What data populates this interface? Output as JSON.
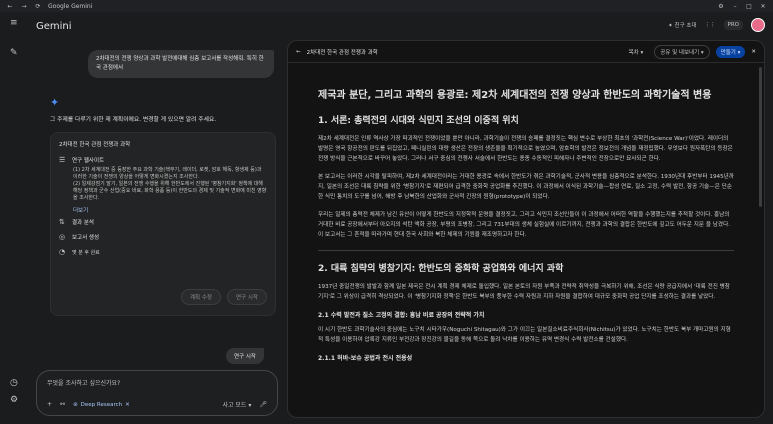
{
  "browser": {
    "tab": "Google Gemini"
  },
  "app": {
    "name": "Gemini",
    "invite": "친구 초대",
    "pro": "PRO"
  },
  "chat": {
    "user_message": "2차대전의 전쟁 양상과 과학 발전에대해 심층 보고서를 작성해줘. 특히 한국 관점에서",
    "reply": "그 주제를 다루기 위한 제 계획이에요. 변경할 게 있으면 알려 주세요.",
    "plan": {
      "title": "2차대전 한국 관점 전쟁과 과학",
      "step1": "연구 웹사이트",
      "step1_desc": "(1) 2차 세계대전 중 등장한 주요 과학 기술(핵무기, 레이더, 로켓, 암호 해독, 항생제 등)과 이러한 기술이 전쟁의 양상을 어떻게 변화시켰는지 조사한다.\n(2) 일제강점기 말기, 일본의 전쟁 수행을 위해 한반도에서 진행된 '병참기지화' 정책에 대해 해당 정책과 군수 산업(중요 비료, 화학 용품 등)이 한반도의 경제 및 기술적 변화에 미친 영향을 조사한다.",
      "more": "더보기",
      "step2": "결과 분석",
      "step3": "보고서 생성",
      "eta": "몇 분 후 완료",
      "edit_btn": "계획 수정",
      "start_btn": "연구 시작"
    },
    "start_msg": "연구 시작"
  },
  "input": {
    "placeholder": "무엇을 조사하고 싶으신가요?",
    "deep_research": "Deep Research",
    "mode": "사고 모드"
  },
  "panel": {
    "title": "2차대전 한국 관점 전쟁과 과학",
    "toc": "목차",
    "share": "공유 및 내보내기",
    "create": "만들기",
    "h1": "제국과 분단, 그리고 과학의 용광로: 제2차 세계대전의 전쟁 양상과 한반도의 과학기술적 변용",
    "s1": "1. 서론: 총력전의 시대와 식민지 조선의 이중적 위치",
    "p1": "제2차 세계대전은 인류 역사상 가장 파괴적인 전쟁이었을 뿐만 아니라, 과학기술이 전쟁의 승패를 결정짓는 핵심 변수로 부상한 최초의 '과학전(Science War)'이었다. 레이더의 발명은 영국 항공전의 판도를 뒤집었고, 페니실린의 대량 생산은 전장의 생존율을 획기적으로 높였으며, 암호학의 발전은 정보전의 개념을 재정립했다. 무엇보다 원자폭탄의 등장은 전쟁 방식을 근본적으로 바꾸어 놓았다. 그러나 서구 중심의 전쟁사 서술에서 한반도는 종종 수동적인 피해자나 주변적인 전장으로만 묘사되곤 한다.",
    "p2": "본 보고서는 이러한 시각을 탈피하여, 제2차 세계대전이라는 거대한 용광로 속에서 한반도가 겪은 과학기술적, 군사적 변용을 심층적으로 분석한다. 1930년대 후반부터 1945년까지, 일본의 조선은 대륙 침략을 위한 '병참기지'로 재편되어 급격한 중화학 공업화를 추진했다. 이 과정에서 이식된 과학기술—합성 연료, 질소 고정, 수력 발전, 항공 기술—은 단순한 식민 통치의 도구를 넘어, 해방 후 남북한의 산업화와 군사적 긴장의 원형(prototype)이 되었다.",
    "p3": "우리는 일제의 총력전 체제가 남긴 유산이 어떻게 한반도의 지정학적 운명을 결정짓고, 그리고 식민지 조선인들이 이 과정에서 어떠한 역할을 수행했는지를 추적할 것이다. 흥남의 거대한 비료 공장에서부터 아오지의 석탄 액화 공장, 부평의 조병창, 그리고 731부대의 생체 실험실에 이르기까지, 전쟁과 과학의 결합은 한반도에 깊고도 어두운 지문 을 남겼다. 이 보고서는 그 흔적을 따라가며 현대 한국 사회와 북한 체제의 기원을 재조명하고자 한다.",
    "s2": "2. 대륙 침략의 병참기지: 한반도의 중화학 공업화와 에너지 과학",
    "p4": "1937년 중일전쟁의 발발과 함께 일본 제국은 전시 계획 경제 체제로 돌입했다. 일본 본토의 자원 부족과 전략적 취약성을 극복하기 위해, 조선은 식량 공급지에서 '대륙 전진 병참기지'로 그 위상이 급격히 격상되었다. 이 '병참기지화 정책'은 한반도 북부의 풍부한 수력 자원과 지하 자원을 결합하여 대규모 중화학 공업 단지를 조성하는 결과를 낳았다.",
    "s21": "2.1 수력 발전과 질소 고정의 결합: 흥남 비료 공장의 전략적 가치",
    "p5": "이 시기 한반도 과학기술사의 중심에는 노구치 시타가우(Noguchi Shitagau)와 그가 이끄는 일본질소비료주식회사(Nichitsu)가 있었다. 노구치는 한반도 북부 개마고원의 지형적 특성을 이용하여 압록강 지류인 부전강과 장진강의 물길을 동해 쪽으로 돌려 낙차를 이용하는 유역 변경식 수력 발전소를 건설했다.",
    "s211": "2.1.1 허바-보슈 공법과 전시 전용성"
  }
}
